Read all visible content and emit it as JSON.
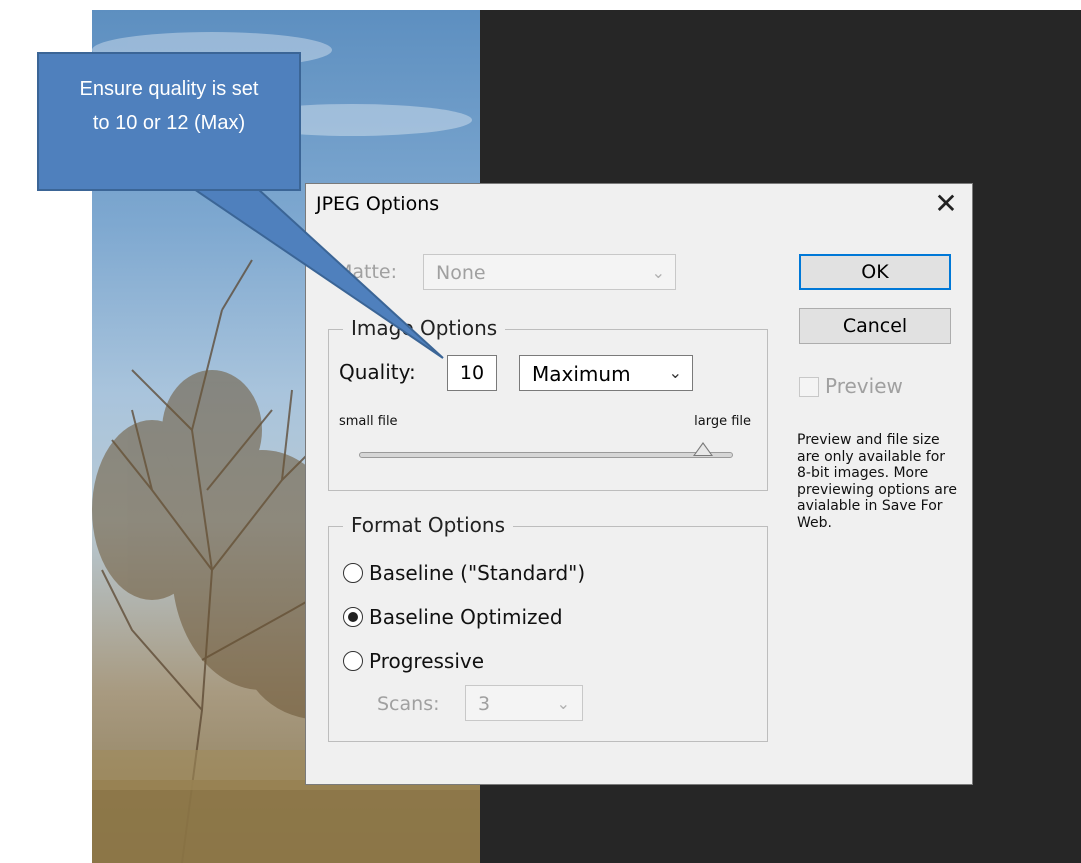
{
  "callout": {
    "line1": "Ensure quality is set",
    "line2": "to 10 or 12 (Max)"
  },
  "dialog": {
    "title": "JPEG Options",
    "close_glyph": "✕",
    "matte": {
      "label": "Matte:",
      "value": "None"
    },
    "image_options": {
      "legend": "Image Options",
      "quality_label": "Quality:",
      "quality_value": "10",
      "quality_preset": "Maximum",
      "small_file": "small file",
      "large_file": "large file",
      "slider_level_fraction": 0.92
    },
    "format_options": {
      "legend": "Format Options",
      "options": [
        "Baseline (\"Standard\")",
        "Baseline Optimized",
        "Progressive"
      ],
      "selected": "Baseline Optimized",
      "scans_label": "Scans:",
      "scans_value": "3"
    },
    "buttons": {
      "ok": "OK",
      "cancel": "Cancel"
    },
    "preview": {
      "label": "Preview",
      "note": "Preview and file size are only available for 8-bit images. More previewing options are avialable in Save For Web."
    }
  },
  "colors": {
    "callout_fill": "#4f80bd",
    "dark_panel": "#262626",
    "dialog_bg": "#f0f0f0",
    "ok_border": "#0078d7"
  }
}
